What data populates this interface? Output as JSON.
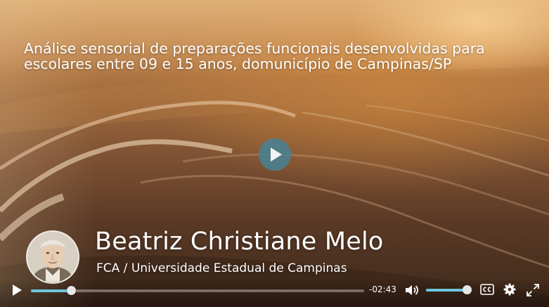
{
  "video": {
    "title": "Análise sensorial de preparações funcionais desenvolvidas para escolares entre 09 e 15 anos, domunicípio de Campinas/SP",
    "speaker_name": "Beatriz Christiane Melo",
    "affiliation": "FCA / Universidade Estadual de Campinas"
  },
  "controls": {
    "time_remaining": "-02:43",
    "progress_fraction": 0.12,
    "volume_fraction": 1.0,
    "icons": [
      "play-icon",
      "volume-icon",
      "closed-captions-icon",
      "settings-gear-icon",
      "fullscreen-icon"
    ]
  },
  "colors": {
    "accent": "#6ec6dc",
    "center_play_button": "#46829a"
  }
}
